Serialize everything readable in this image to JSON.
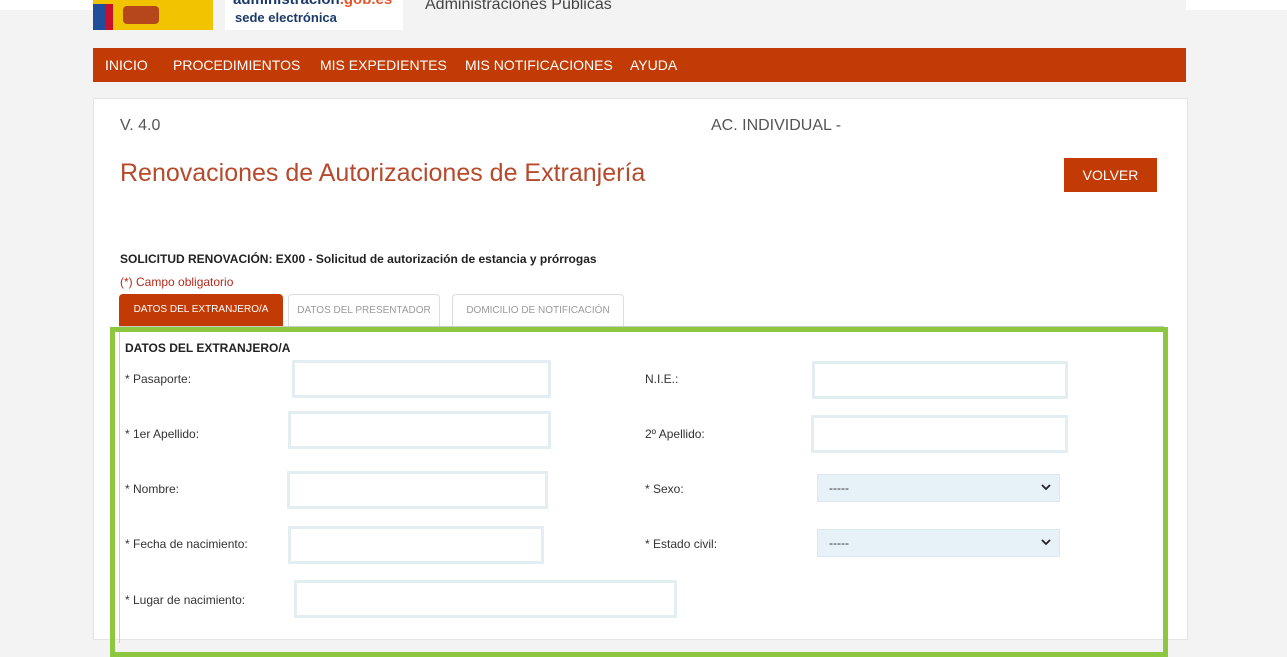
{
  "header": {
    "sede_top_a": "administración",
    "sede_top_b": ".gob.es",
    "sede_bottom": "sede electrónica",
    "title": "Administraciones Públicas"
  },
  "nav": [
    "INICIO",
    "PROCEDIMIENTOS",
    "MIS EXPEDIENTES",
    "MIS NOTIFICACIONES",
    "AYUDA"
  ],
  "page": {
    "version": "V. 4.0",
    "ac": "AC. INDIVIDUAL -",
    "title": "Renovaciones de Autorizaciones de Extranjería",
    "volver": "VOLVER",
    "solicitud_label": "SOLICITUD RENOVACIÓN:",
    "solicitud_value": "EX00 - Solicitud de autorización de estancia y prórrogas",
    "obligatorio": "(*) Campo obligatorio"
  },
  "tabs": [
    "DATOS DEL EXTRANJERO/A",
    "DATOS DEL PRESENTADOR",
    "DOMICILIO DE NOTIFICACIÓN"
  ],
  "form": {
    "heading": "DATOS DEL EXTRANJERO/A",
    "labels": {
      "pasaporte": "* Pasaporte:",
      "nie": "N.I.E.:",
      "apellido1": "* 1er Apellido:",
      "apellido2": "2º Apellido:",
      "nombre": "* Nombre:",
      "sexo": "* Sexo:",
      "fecha": "* Fecha de nacimiento:",
      "estado_civil": "* Estado civil:",
      "lugar": "* Lugar de nacimiento:"
    },
    "values": {
      "pasaporte": "",
      "nie": "",
      "apellido1": "",
      "apellido2": "",
      "nombre": "",
      "fecha": "",
      "lugar": ""
    },
    "selects": {
      "sexo": "-----",
      "estado_civil": "-----"
    }
  },
  "colors": {
    "brand": "#c23a04",
    "title": "#b54a2c",
    "highlight": "#8dc63f"
  }
}
